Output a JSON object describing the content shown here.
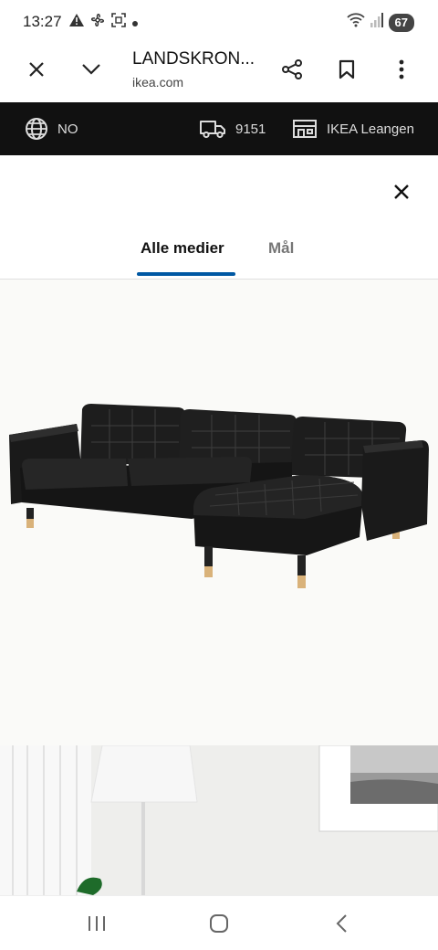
{
  "status_bar": {
    "time": "13:27",
    "battery": "67",
    "left_icons": [
      "alert-icon",
      "fan-icon",
      "screenshot-icon",
      "dot-icon"
    ],
    "right_icons": [
      "wifi-icon",
      "signal-icon",
      "battery-icon"
    ]
  },
  "browser": {
    "title": "LANDSKRON...",
    "domain": "ikea.com",
    "icons": [
      "close-icon",
      "chevron-down-icon",
      "share-icon",
      "bookmark-icon",
      "more-vert-icon"
    ]
  },
  "ikea_bar": {
    "language": "NO",
    "postcode": "9151",
    "store": "IKEA Leangen"
  },
  "media_sheet": {
    "tabs": [
      {
        "label": "Alle medier",
        "active": true
      },
      {
        "label": "Mål",
        "active": false
      }
    ],
    "accent_color": "#0058a3"
  },
  "colors": {
    "ikea_bar_bg": "#111111",
    "tab_active": "#111111",
    "tab_inactive": "#767676"
  }
}
